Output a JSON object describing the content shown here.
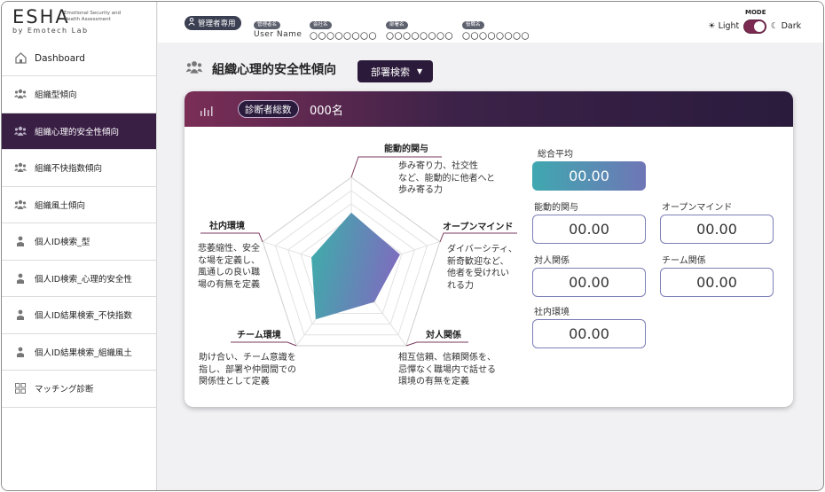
{
  "logo": {
    "main": "ESHA",
    "sub": "by Emotech Lab",
    "desc": "Emotional Security and Health Assessment"
  },
  "topbar": {
    "admin_badge": "管理者専用",
    "info": [
      {
        "label": "管理者名",
        "value": "User Name"
      },
      {
        "label": "会社名",
        "value": "〇〇〇〇〇〇〇〇"
      },
      {
        "label": "部署名",
        "value": "〇〇〇〇〇〇〇〇"
      },
      {
        "label": "役職名",
        "value": "〇〇〇〇〇〇〇〇"
      }
    ],
    "mode": {
      "label": "MODE",
      "light": "Light",
      "dark": "Dark",
      "selected": "dark"
    }
  },
  "sidebar": {
    "items": [
      {
        "label": "Dashboard",
        "icon": "home-icon",
        "active": false
      },
      {
        "label": "組織型傾向",
        "icon": "group-icon",
        "active": false
      },
      {
        "label": "組織心理的安全性傾向",
        "icon": "group-icon",
        "active": true
      },
      {
        "label": "組織不快指数傾向",
        "icon": "group-icon",
        "active": false
      },
      {
        "label": "組織風土傾向",
        "icon": "group-icon",
        "active": false
      },
      {
        "label": "個人ID検索_型",
        "icon": "person-icon",
        "active": false
      },
      {
        "label": "個人ID検索_心理的安全性",
        "icon": "person-icon",
        "active": false
      },
      {
        "label": "個人ID結果検索_不快指数",
        "icon": "person-icon",
        "active": false
      },
      {
        "label": "個人ID結果検索_組織風土",
        "icon": "person-icon",
        "active": false
      },
      {
        "label": "マッチング診断",
        "icon": "grid-icon",
        "active": false
      }
    ]
  },
  "page": {
    "title": "組織心理的安全性傾向",
    "dept_button": "部署検索"
  },
  "card": {
    "badge": "診断者総数",
    "count": "000名"
  },
  "axes": [
    {
      "title": "能動的関与",
      "desc": "歩み寄り力、社交性\nなど、能動的に他者へと\n歩み寄る力",
      "value": 0.62
    },
    {
      "title": "オープンマインド",
      "desc": "ダイバーシティ、\n新奇歓迎など、\n他者を受けれい\nれる力",
      "value": 0.55
    },
    {
      "title": "対人関係",
      "desc": "相互信頼、信頼関係を、\n忌憚なく職場内で話せる\n環境の有無を定義",
      "value": 0.42
    },
    {
      "title": "チーム環境",
      "desc": "助け合い、チーム意識を\n指し、部署や仲間間での\n関係性として定義",
      "value": 0.65
    },
    {
      "title": "社内環境",
      "desc": "悲萎縮性、安全\nな場を定義し、\n風通しの良い職\n場の有無を定義",
      "value": 0.45
    }
  ],
  "scores": {
    "total": {
      "label": "総合平均",
      "value": "00.00"
    },
    "active": {
      "label": "能動的関与",
      "value": "00.00"
    },
    "open": {
      "label": "オープンマインド",
      "value": "00.00"
    },
    "interpersonal": {
      "label": "対人関係",
      "value": "00.00"
    },
    "team": {
      "label": "チーム関係",
      "value": "00.00"
    },
    "company": {
      "label": "社内環境",
      "value": "00.00"
    }
  },
  "colors": {
    "accent_dark": "#2b1a3a",
    "accent_plum": "#7a2e56",
    "radar_teal": "#3ab0a8",
    "radar_purple": "#7b6fbe"
  }
}
